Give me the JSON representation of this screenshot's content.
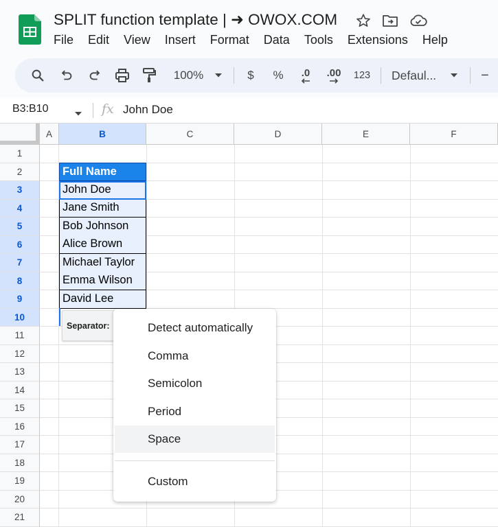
{
  "app": {
    "title": "SPLIT function template | ➜ OWOX.COM",
    "menu": [
      "File",
      "Edit",
      "View",
      "Insert",
      "Format",
      "Data",
      "Tools",
      "Extensions",
      "Help"
    ],
    "accent_color": "#0f9d58"
  },
  "toolbar": {
    "zoom": "100%",
    "currency": "$",
    "percent": "%",
    "decrease_decimal": ".0",
    "increase_decimal": ".00",
    "number_format": "123",
    "font": "Defaul...",
    "minus": "−"
  },
  "formula_bar": {
    "name_box": "B3:B10",
    "fx": "fx",
    "value": "John Doe"
  },
  "grid": {
    "columns": [
      "A",
      "B",
      "C",
      "D",
      "E",
      "F"
    ],
    "rows": [
      "1",
      "2",
      "3",
      "4",
      "5",
      "6",
      "7",
      "8",
      "9",
      "10",
      "11",
      "12",
      "13",
      "14",
      "15",
      "16",
      "17",
      "18",
      "19",
      "20",
      "21"
    ],
    "header_cell": "Full Name",
    "names": [
      "John Doe",
      "Jane Smith",
      "Bob Johnson",
      "Alice Brown",
      "Michael Taylor",
      "Emma Wilson",
      "David Lee"
    ],
    "header_fill": "#1a84ea",
    "data_fill": "#e8f0fe"
  },
  "separator": {
    "label": "Separator:",
    "options": [
      "Detect automatically",
      "Comma",
      "Semicolon",
      "Period",
      "Space",
      "Custom"
    ],
    "highlighted": "Space"
  }
}
